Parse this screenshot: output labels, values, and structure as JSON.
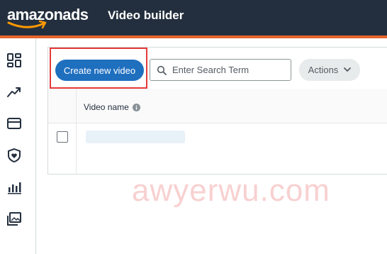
{
  "header": {
    "logo_text": "amazonads",
    "page_title": "Video builder",
    "accent_color": "#e5642e",
    "background_color": "#232f3e"
  },
  "sidebar": {
    "icons": [
      "dashboard-icon",
      "trend-icon",
      "wallet-icon",
      "shield-heart-icon",
      "bar-chart-icon",
      "media-library-icon"
    ]
  },
  "toolbar": {
    "create_label": "Create new video",
    "search_placeholder": "Enter Search Term",
    "actions_label": "Actions"
  },
  "table": {
    "columns": [
      "Video name"
    ],
    "rows": [
      {
        "video_name": "",
        "selected": false
      }
    ]
  },
  "watermark": "awyerwu.com"
}
